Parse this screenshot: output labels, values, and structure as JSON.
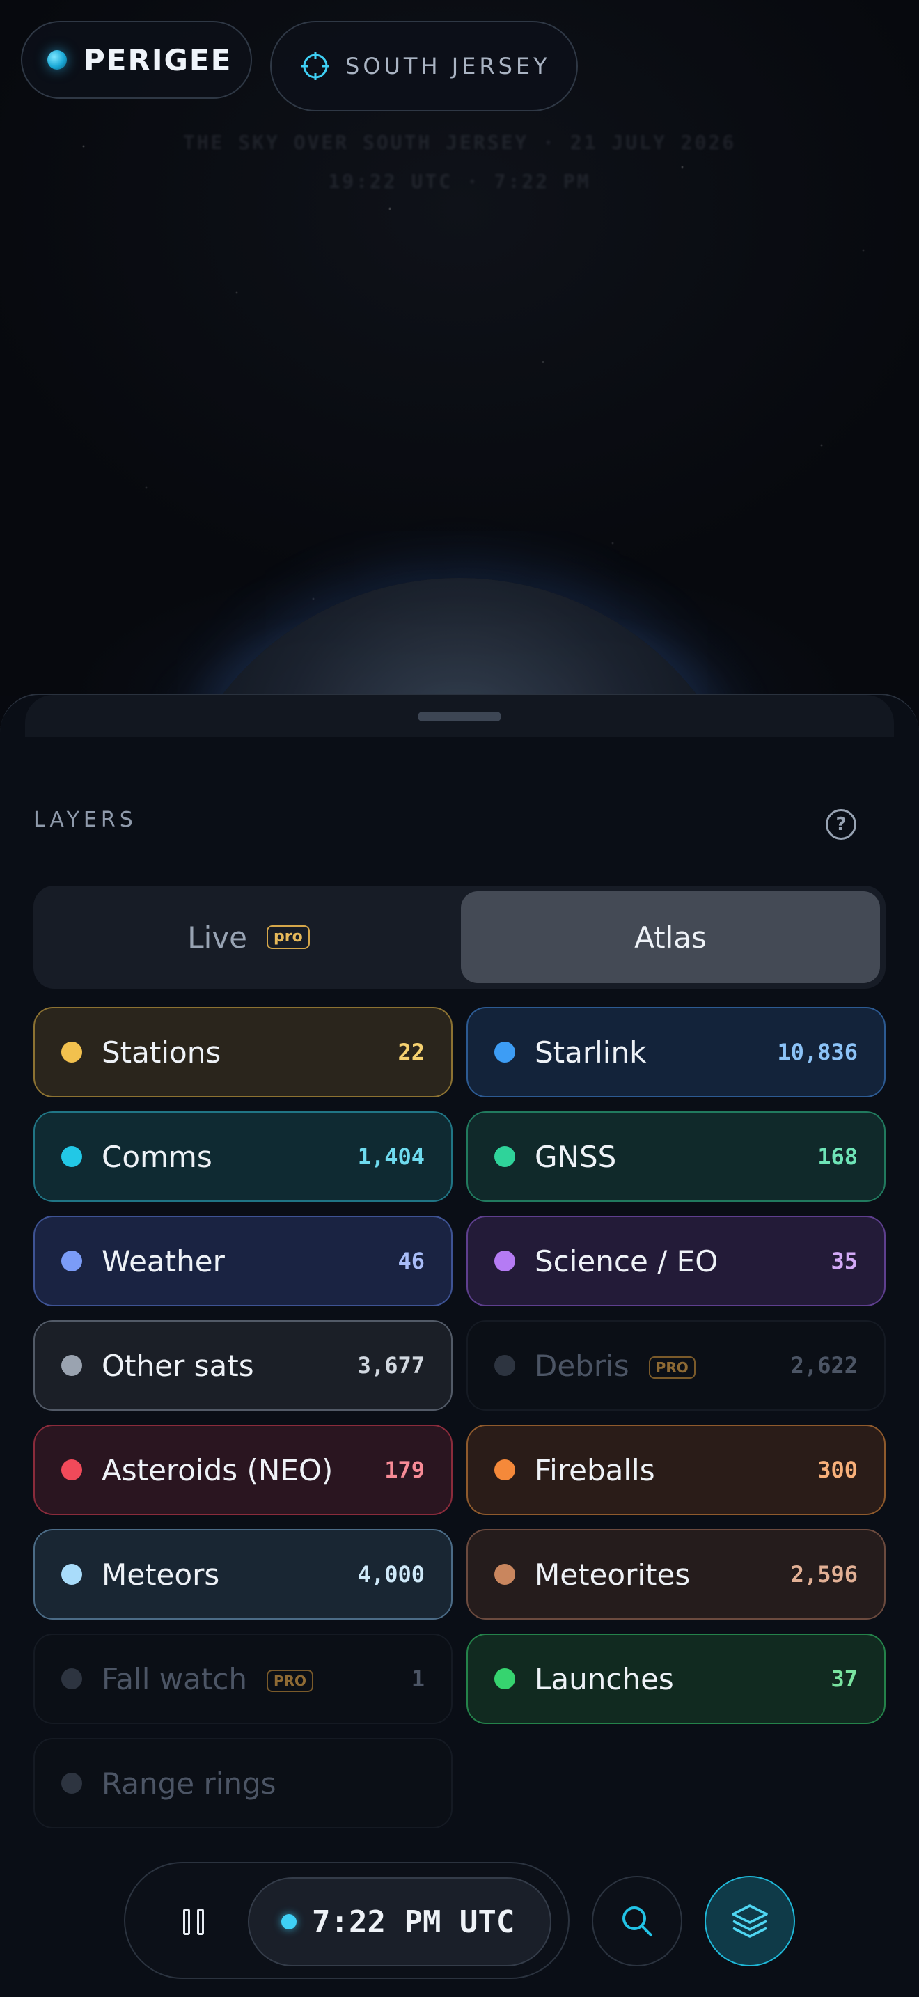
{
  "header": {
    "brand": "PERIGEE",
    "location": "SOUTH JERSEY",
    "faint_line_1": "THE SKY OVER SOUTH JERSEY · 21 JULY 2026",
    "faint_line_2": "19:22 UTC · 7:22 PM"
  },
  "sheet": {
    "title": "LAYERS",
    "help_glyph": "?",
    "tabs": [
      {
        "label": "Live",
        "badge": "pro",
        "active": false
      },
      {
        "label": "Atlas",
        "active": true
      }
    ],
    "layers": [
      {
        "label": "Stations",
        "count": "22",
        "color": "#f2c14e",
        "bg": "#2a251c",
        "border": "#8c7232",
        "count_color": "#f5d170",
        "enabled": true
      },
      {
        "label": "Starlink",
        "count": "10,836",
        "color": "#3d9df5",
        "bg": "#13233a",
        "border": "#2c5a92",
        "count_color": "#8cc3f7",
        "enabled": true
      },
      {
        "label": "Comms",
        "count": "1,404",
        "color": "#22c8e6",
        "bg": "#0f2a32",
        "border": "#207585",
        "count_color": "#6fdbef",
        "enabled": true
      },
      {
        "label": "GNSS",
        "count": "168",
        "color": "#2fd39a",
        "bg": "#10292a",
        "border": "#217a5e",
        "count_color": "#6fe4b7",
        "enabled": true
      },
      {
        "label": "Weather",
        "count": "46",
        "color": "#7b9cf7",
        "bg": "#1a2342",
        "border": "#3e5394",
        "count_color": "#a9bdf8",
        "enabled": true
      },
      {
        "label": "Science / EO",
        "count": "35",
        "color": "#b57bf4",
        "bg": "#231b38",
        "border": "#5e3f8e",
        "count_color": "#d3aaf7",
        "enabled": true
      },
      {
        "label": "Other sats",
        "count": "3,677",
        "color": "#9aa3b0",
        "bg": "#1b1f27",
        "border": "#525a67",
        "count_color": "#d2d8e0",
        "enabled": true
      },
      {
        "label": "Debris",
        "count": "2,622",
        "badge": "PRO",
        "color": "#2d3440",
        "bg": "#0b0f16",
        "border": "#151a23",
        "count_color": "#4c5565",
        "enabled": false
      },
      {
        "label": "Asteroids (NEO)",
        "count": "179",
        "color": "#f04a5a",
        "bg": "#2a1520",
        "border": "#8a2b3b",
        "count_color": "#f78b96",
        "enabled": true
      },
      {
        "label": "Fireballs",
        "count": "300",
        "color": "#f5893a",
        "bg": "#2a1c18",
        "border": "#8f5a2c",
        "count_color": "#f8b07a",
        "enabled": true
      },
      {
        "label": "Meteors",
        "count": "4,000",
        "color": "#a9dcfa",
        "bg": "#192633",
        "border": "#4b6b86",
        "count_color": "#cfe9f9",
        "enabled": true
      },
      {
        "label": "Meteorites",
        "count": "2,596",
        "color": "#c9865e",
        "bg": "#251c1c",
        "border": "#6b4a3e",
        "count_color": "#e2b095",
        "enabled": true
      },
      {
        "label": "Fall watch",
        "count": "1",
        "badge": "PRO",
        "color": "#2d3440",
        "bg": "#0b0f16",
        "border": "#151a23",
        "count_color": "#4c5565",
        "enabled": false
      },
      {
        "label": "Launches",
        "count": "37",
        "color": "#36d46f",
        "bg": "#112a20",
        "border": "#24824a",
        "count_color": "#7ae4a0",
        "enabled": true
      },
      {
        "label": "Range rings",
        "count": "",
        "color": "#2d3440",
        "bg": "#0b0f16",
        "border": "#151a23",
        "count_color": "#4c5565",
        "enabled": false
      }
    ]
  },
  "bottom_bar": {
    "time": "7:22 PM UTC",
    "pause_icon": "pause-icon",
    "search_icon": "search-icon",
    "layers_icon": "layers-icon",
    "accent": "#22c3e6"
  }
}
